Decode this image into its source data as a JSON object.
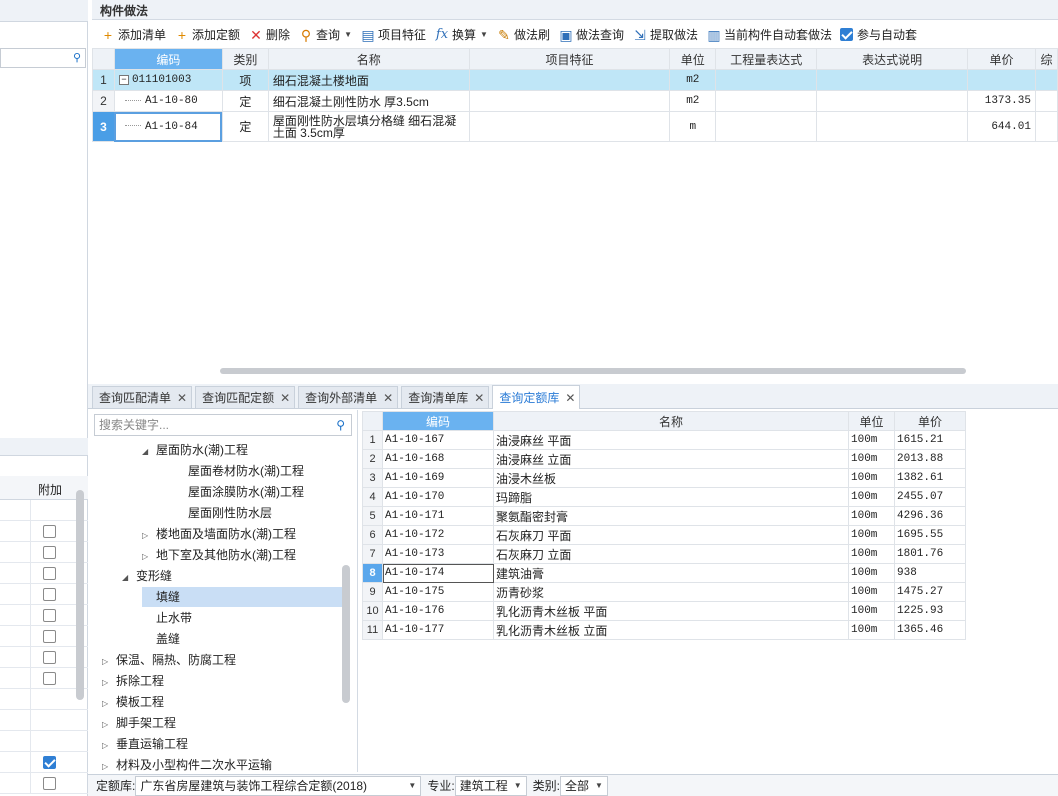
{
  "panel": {
    "title": "构件做法"
  },
  "toolbar": {
    "items": [
      {
        "label": "添加清单",
        "icon": "add-list-icon"
      },
      {
        "label": "添加定额",
        "icon": "add-quota-icon"
      },
      {
        "label": "删除",
        "icon": "delete-icon"
      },
      {
        "label": "查询",
        "icon": "query-icon"
      },
      {
        "label": "项目特征",
        "icon": "feature-icon"
      },
      {
        "label": "换算",
        "icon": "fx-icon"
      },
      {
        "label": "做法刷",
        "icon": "brush-icon"
      },
      {
        "label": "做法查询",
        "icon": "method-query-icon"
      },
      {
        "label": "提取做法",
        "icon": "extract-icon"
      },
      {
        "label": "当前构件自动套做法",
        "icon": "auto-apply-icon"
      },
      {
        "label": "参与自动套",
        "icon": "checkbox-icon"
      }
    ]
  },
  "main_grid": {
    "columns": [
      "编码",
      "类别",
      "名称",
      "项目特征",
      "单位",
      "工程量表达式",
      "表达式说明",
      "单价",
      "综"
    ],
    "rows": [
      {
        "rn": "1",
        "toggle": "−",
        "code": "011101003",
        "type": "项",
        "name": "细石混凝土楼地面",
        "feature": "",
        "unit": "m2",
        "expr": "",
        "desc": "",
        "price": ""
      },
      {
        "rn": "2",
        "code": "A1-10-80",
        "type": "定",
        "name": "细石混凝土刚性防水 厚3.5cm",
        "feature": "",
        "unit": "m2",
        "expr": "",
        "desc": "",
        "price": "1373.35"
      },
      {
        "rn": "3",
        "code": "A1-10-84",
        "type": "定",
        "name": "屋面刚性防水层填分格缝 细石混凝土面 3.5cm厚",
        "feature": "",
        "unit": "m",
        "expr": "",
        "desc": "",
        "price": "644.01"
      }
    ]
  },
  "tabs": [
    {
      "label": "查询匹配清单",
      "active": false
    },
    {
      "label": "查询匹配定额",
      "active": false
    },
    {
      "label": "查询外部清单",
      "active": false
    },
    {
      "label": "查询清单库",
      "active": false
    },
    {
      "label": "查询定额库",
      "active": true
    }
  ],
  "tree": {
    "search_placeholder": "搜索关键字...",
    "nodes": [
      {
        "label": "屋面防水(潮)工程",
        "toggle": "◢",
        "level": 2
      },
      {
        "label": "屋面卷材防水(潮)工程",
        "toggle": "",
        "level": 3
      },
      {
        "label": "屋面涂膜防水(潮)工程",
        "toggle": "",
        "level": 3
      },
      {
        "label": "屋面刚性防水层",
        "toggle": "",
        "level": 3
      },
      {
        "label": "楼地面及墙面防水(潮)工程",
        "toggle": "▷",
        "level": 2
      },
      {
        "label": "地下室及其他防水(潮)工程",
        "toggle": "▷",
        "level": 2
      },
      {
        "label": "变形缝",
        "toggle": "◢",
        "level": 1
      },
      {
        "label": "填缝",
        "toggle": "",
        "level": 2,
        "selected": true
      },
      {
        "label": "止水带",
        "toggle": "",
        "level": 2
      },
      {
        "label": "盖缝",
        "toggle": "",
        "level": 2
      },
      {
        "label": "保温、隔热、防腐工程",
        "toggle": "▷",
        "level": 0
      },
      {
        "label": "拆除工程",
        "toggle": "▷",
        "level": 0
      },
      {
        "label": "模板工程",
        "toggle": "▷",
        "level": 0
      },
      {
        "label": "脚手架工程",
        "toggle": "▷",
        "level": 0
      },
      {
        "label": "垂直运输工程",
        "toggle": "▷",
        "level": 0
      },
      {
        "label": "材料及小型构件二次水平运输",
        "toggle": "▷",
        "level": 0
      }
    ]
  },
  "lib_grid": {
    "columns": [
      "编码",
      "名称",
      "单位",
      "单价"
    ],
    "rows": [
      {
        "rn": "1",
        "code": "A1-10-167",
        "name": "油浸麻丝 平面",
        "unit": "100m",
        "price": "1615.21"
      },
      {
        "rn": "2",
        "code": "A1-10-168",
        "name": "油浸麻丝 立面",
        "unit": "100m",
        "price": "2013.88"
      },
      {
        "rn": "3",
        "code": "A1-10-169",
        "name": "油浸木丝板",
        "unit": "100m",
        "price": "1382.61"
      },
      {
        "rn": "4",
        "code": "A1-10-170",
        "name": "玛蹄脂",
        "unit": "100m",
        "price": "2455.07"
      },
      {
        "rn": "5",
        "code": "A1-10-171",
        "name": "聚氨酯密封膏",
        "unit": "100m",
        "price": "4296.36"
      },
      {
        "rn": "6",
        "code": "A1-10-172",
        "name": "石灰麻刀 平面",
        "unit": "100m",
        "price": "1695.55"
      },
      {
        "rn": "7",
        "code": "A1-10-173",
        "name": "石灰麻刀 立面",
        "unit": "100m",
        "price": "1801.76"
      },
      {
        "rn": "8",
        "code": "A1-10-174",
        "name": "建筑油膏",
        "unit": "100m",
        "price": "938"
      },
      {
        "rn": "9",
        "code": "A1-10-175",
        "name": "沥青砂浆",
        "unit": "100m",
        "price": "1475.27"
      },
      {
        "rn": "10",
        "code": "A1-10-176",
        "name": "乳化沥青木丝板 平面",
        "unit": "100m",
        "price": "1225.93"
      },
      {
        "rn": "11",
        "code": "A1-10-177",
        "name": "乳化沥青木丝板 立面",
        "unit": "100m",
        "price": "1365.46"
      }
    ]
  },
  "status": {
    "lib_label": "定额库:",
    "lib_value": "广东省房屋建筑与装饰工程综合定额(2018)",
    "major_label": "专业:",
    "major_value": "建筑工程",
    "type_label": "类别:",
    "type_value": "全部"
  },
  "left": {
    "col_header": "附加"
  }
}
